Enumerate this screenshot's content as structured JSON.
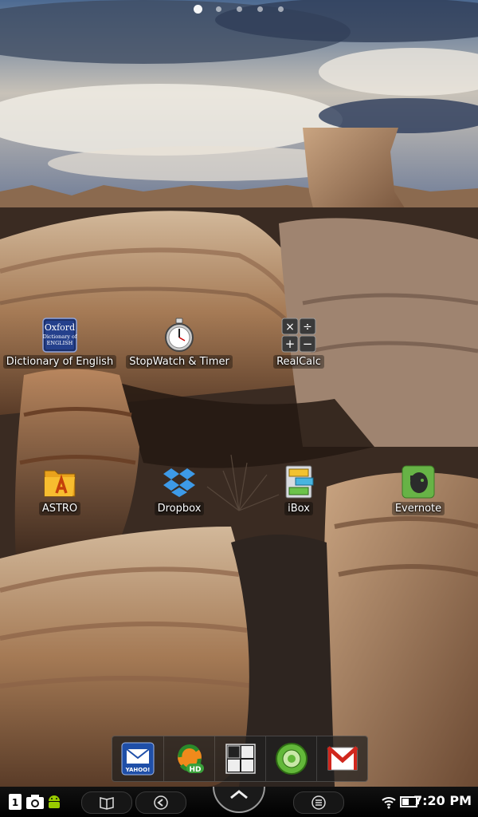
{
  "page_indicator": {
    "total": 5,
    "active_index": 0
  },
  "apps": [
    {
      "id": "oxford",
      "label": "Dictionary of English",
      "icon": "oxford-dictionary-icon",
      "icon_text": [
        "Oxford",
        "Dictionary of",
        "ENGLISH"
      ]
    },
    {
      "id": "stopwatch",
      "label": "StopWatch & Timer",
      "icon": "stopwatch-icon"
    },
    {
      "id": "realcalc",
      "label": "RealCalc",
      "icon": "calculator-icon"
    },
    {
      "id": "astro",
      "label": "ASTRO",
      "icon": "astro-folder-icon"
    },
    {
      "id": "dropbox",
      "label": "Dropbox",
      "icon": "dropbox-icon"
    },
    {
      "id": "ibox",
      "label": "iBox",
      "icon": "ibox-cabinet-icon"
    },
    {
      "id": "evernote",
      "label": "Evernote",
      "icon": "evernote-icon"
    }
  ],
  "dock": [
    {
      "id": "yahoo-mail",
      "icon": "yahoo-mail-icon",
      "icon_text": "YAHOO!"
    },
    {
      "id": "hd-app",
      "icon": "hd-refresh-icon",
      "icon_text": "HD"
    },
    {
      "id": "app-drawer",
      "icon": "app-grid-icon"
    },
    {
      "id": "green-ring",
      "icon": "green-ring-icon"
    },
    {
      "id": "gmail",
      "icon": "gmail-icon"
    }
  ],
  "status_bar": {
    "notification_count": "1",
    "time": "7:20 PM",
    "icons": [
      "notification-count-icon",
      "camera-icon",
      "android-icon",
      "wifi-icon",
      "battery-icon"
    ],
    "buttons": [
      "book-button",
      "back-button",
      "home-button",
      "menu-button"
    ]
  }
}
